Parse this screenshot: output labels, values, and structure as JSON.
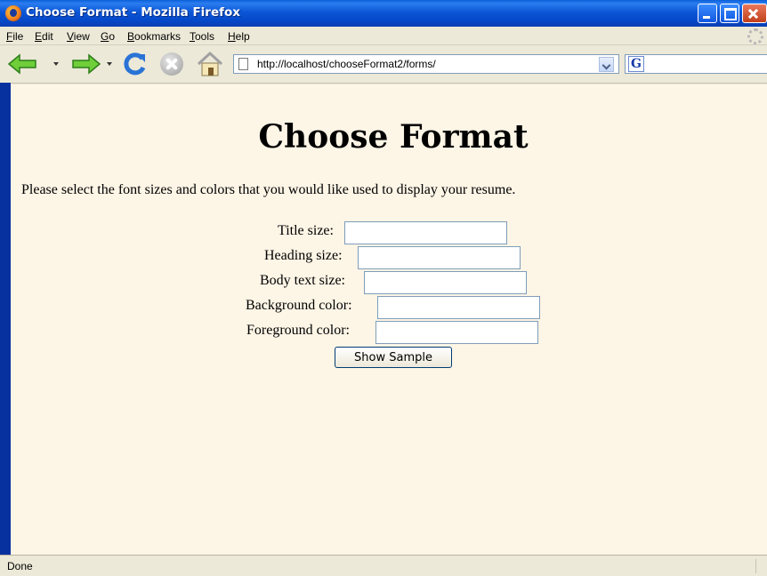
{
  "window": {
    "title": "Choose Format - Mozilla Firefox",
    "controls": {
      "minimize": "minimize-icon",
      "maximize": "maximize-icon",
      "close": "close-icon"
    }
  },
  "menubar": {
    "items": [
      {
        "label": "File",
        "mnemonic": "F",
        "rest": "ile"
      },
      {
        "label": "Edit",
        "mnemonic": "E",
        "rest": "dit"
      },
      {
        "label": "View",
        "mnemonic": "V",
        "rest": "iew"
      },
      {
        "label": "Go",
        "mnemonic": "G",
        "rest": "o"
      },
      {
        "label": "Bookmarks",
        "mnemonic": "B",
        "rest": "ookmarks"
      },
      {
        "label": "Tools",
        "mnemonic": "T",
        "rest": "ools"
      },
      {
        "label": "Help",
        "mnemonic": "H",
        "rest": "elp"
      }
    ]
  },
  "navbar": {
    "icons": [
      "back-arrow-icon",
      "forward-arrow-icon",
      "reload-icon",
      "stop-icon",
      "home-icon"
    ],
    "url": "http://localhost/chooseFormat2/forms/",
    "search_engine_icon": "G"
  },
  "page": {
    "title": "Choose Format",
    "intro": "Please select the font sizes and colors that you would like used to display your resume.",
    "fields": [
      {
        "label": "Title size:",
        "value": ""
      },
      {
        "label": "Heading size:",
        "value": ""
      },
      {
        "label": "Body text size:",
        "value": ""
      },
      {
        "label": "Background color:",
        "value": ""
      },
      {
        "label": "Foreground color:",
        "value": ""
      }
    ],
    "submit_label": "Show Sample",
    "background_color": "#fdf5e6"
  },
  "statusbar": {
    "text": "Done"
  }
}
